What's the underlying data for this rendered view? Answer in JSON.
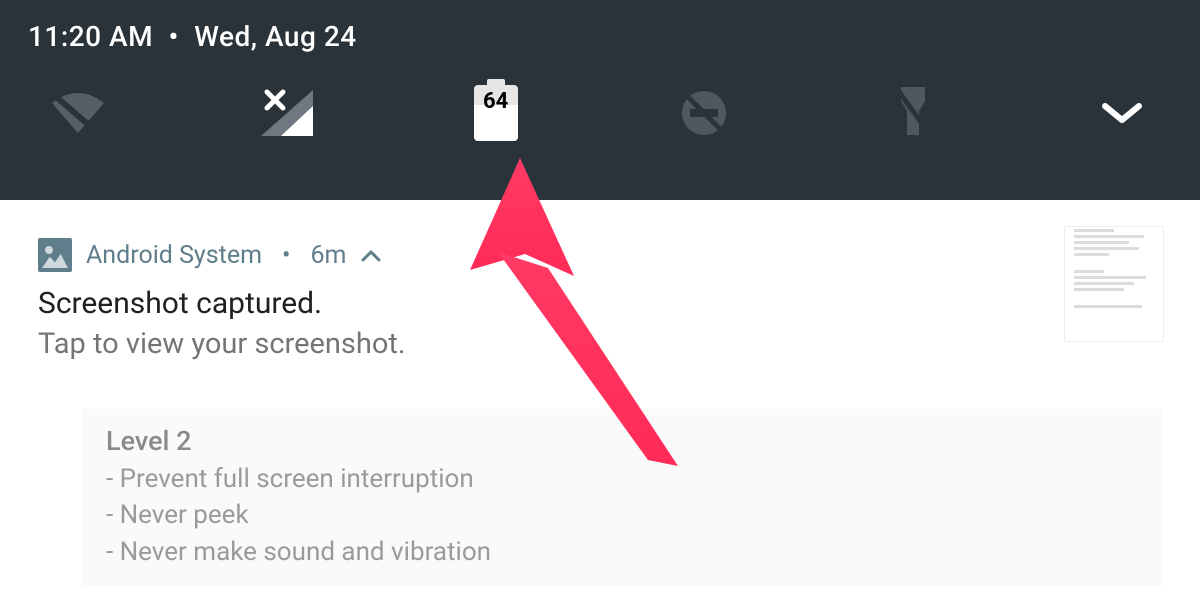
{
  "statusbar": {
    "time": "11:20 AM",
    "date": "Wed, Aug 24",
    "battery_percent": "64"
  },
  "notification": {
    "app_name": "Android System",
    "age": "6m",
    "title": "Screenshot captured.",
    "subtitle": "Tap to view your screenshot."
  },
  "card": {
    "title": "Level 2",
    "lines": [
      "- Prevent full screen interruption",
      "- Never peek",
      "- Never make sound and vibration"
    ]
  }
}
